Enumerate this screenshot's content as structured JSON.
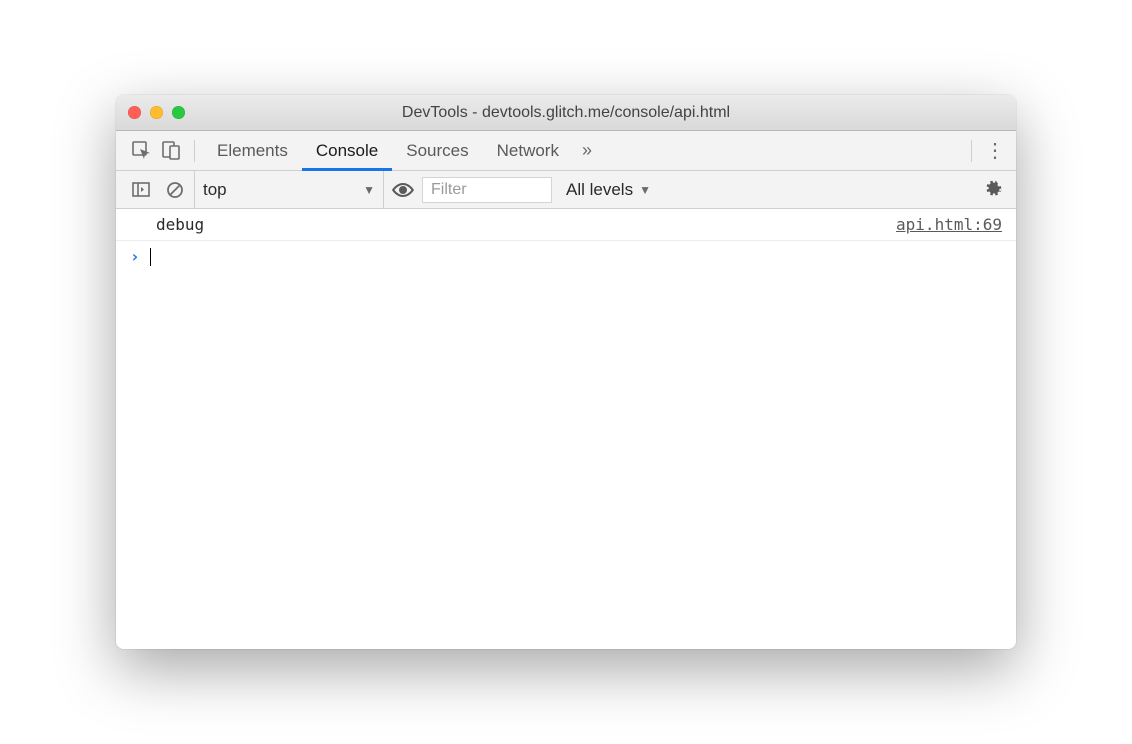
{
  "window": {
    "title": "DevTools - devtools.glitch.me/console/api.html"
  },
  "tabs": {
    "elements": "Elements",
    "console": "Console",
    "sources": "Sources",
    "network": "Network",
    "more_glyph": "»",
    "menu_glyph": "⋮"
  },
  "subtoolbar": {
    "context": "top",
    "filter_placeholder": "Filter",
    "filter_value": "",
    "levels_label": "All levels",
    "caret_glyph": "▼"
  },
  "console": {
    "logs": [
      {
        "message": "debug",
        "source": "api.html:69"
      }
    ],
    "prompt_glyph": "›"
  }
}
